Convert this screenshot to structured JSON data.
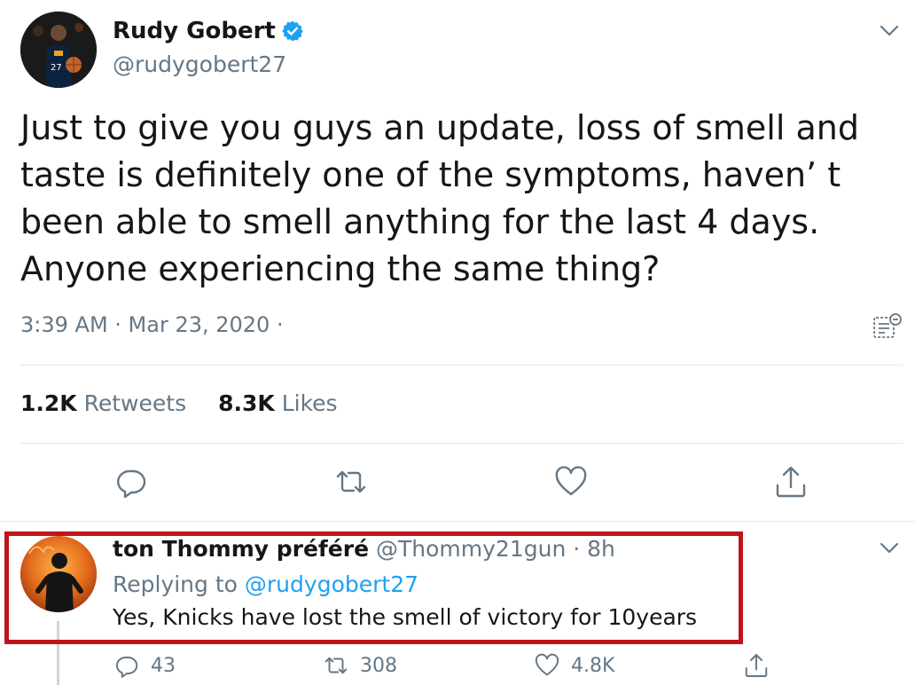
{
  "tweet": {
    "author_name": "Rudy Gobert",
    "author_handle": "@rudygobert27",
    "text": "Just to give you guys an update, loss of smell and\ntaste is definitely one of the symptoms, haven’ t\nbeen able to smell anything for the last 4 days.\nAnyone experiencing the same thing?",
    "timestamp": "3:39 AM · Mar 23, 2020 ·",
    "retweets_count": "1.2K",
    "retweets_label": "Retweets",
    "likes_count": "8.3K",
    "likes_label": "Likes"
  },
  "reply": {
    "author_name": "ton Thommy préféré",
    "meta": "@Thommy21gun · 8h",
    "replying_prefix": "Replying to",
    "replying_mention": "@rudygobert27",
    "text": "Yes, Knicks have lost the smell of victory for 10years",
    "reply_count": "43",
    "retweet_count": "308",
    "like_count": "4.8K"
  },
  "colors": {
    "text_primary": "#14171a",
    "text_secondary": "#657786",
    "accent": "#1da1f2",
    "highlight_border": "#c0141a",
    "divider": "#e1e8ed"
  },
  "icons": [
    "verified-badge-icon",
    "chevron-down-icon",
    "source-label-icon",
    "reply-icon",
    "retweet-icon",
    "like-icon",
    "share-icon"
  ]
}
